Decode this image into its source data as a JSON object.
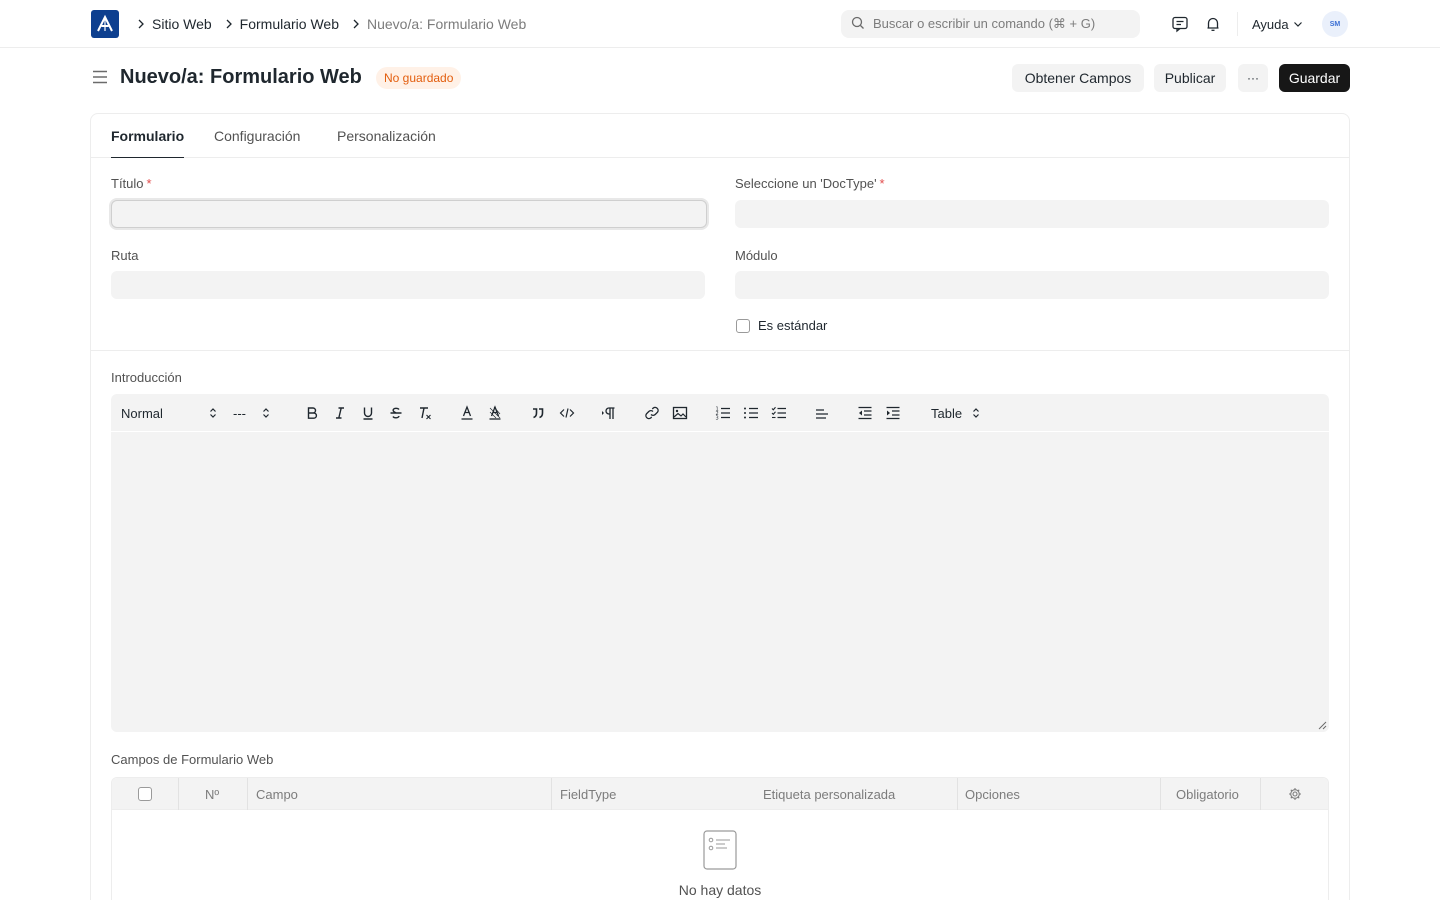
{
  "navbar": {
    "breadcrumbs": [
      "Sitio Web",
      "Formulario Web",
      "Nuevo/a: Formulario Web"
    ],
    "search_placeholder": "Buscar o escribir un comando (⌘ + G)",
    "help_label": "Ayuda",
    "avatar_initials": "SM"
  },
  "page": {
    "title": "Nuevo/a: Formulario Web",
    "status_badge": "No guardado",
    "buttons": {
      "get_fields": "Obtener Campos",
      "publish": "Publicar",
      "more": "···",
      "save": "Guardar"
    }
  },
  "tabs": [
    "Formulario",
    "Configuración",
    "Personalización"
  ],
  "form": {
    "title_label": "Título",
    "doctype_label": "Seleccione un 'DocType'",
    "route_label": "Ruta",
    "module_label": "Módulo",
    "is_standard_label": "Es estándar",
    "intro_label": "Introducción",
    "title_value": "",
    "doctype_value": "",
    "route_value": "",
    "module_value": ""
  },
  "editor": {
    "header_select": "Normal",
    "size_select": "---",
    "table_select": "Table"
  },
  "fields_table": {
    "label": "Campos de Formulario Web",
    "columns": [
      "Nº",
      "Campo",
      "FieldType",
      "Etiqueta personalizada",
      "Opciones",
      "Obligatorio"
    ],
    "empty_text": "No hay datos"
  },
  "colors": {
    "accent": "#171717",
    "logo": "#0d3f8f",
    "badge_bg": "#fff1e7",
    "badge_text": "#e35e0e",
    "required": "#e24c4c"
  },
  "icons": [
    "app-logo-icon",
    "chevron-right-icon",
    "search-icon",
    "chat-icon",
    "bell-icon",
    "chevron-down-icon",
    "hamburger-icon",
    "gear-icon",
    "empty-list-icon"
  ]
}
